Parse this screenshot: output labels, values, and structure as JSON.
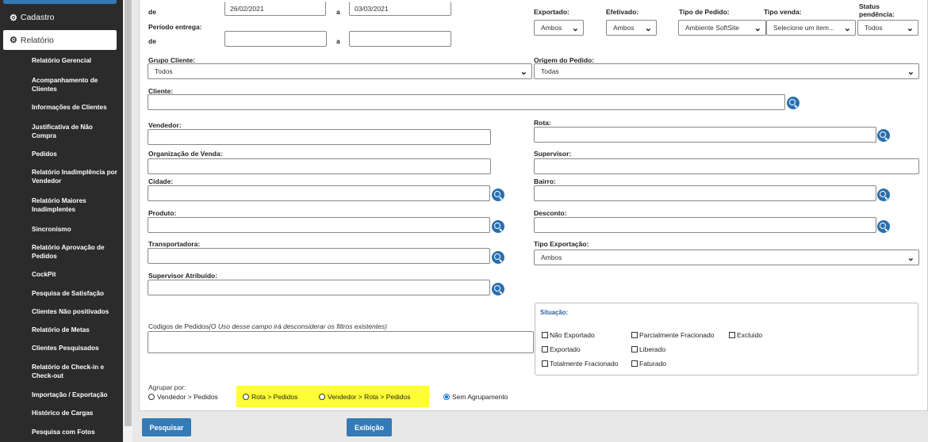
{
  "sidebar": {
    "cadastro": "Cadastro",
    "relatorio": "Relatório",
    "items": [
      "Relatório Gerencial",
      "Acompanhamento de Clientes",
      "Informações de Clientes",
      "Justificativa de Não Compra",
      "Pedidos",
      "Relatório Inadimplência por Vendedor",
      "Relatório Maiores Inadimplentes",
      "Sincronismo",
      "Relatório Aprovação de Pedidos",
      "CockPit",
      "Pesquisa de Satisfação",
      "Clientes Não positivados",
      "Relatório de Metas",
      "Clientes Pesquisados",
      "Relatório de Check-in e Check-out",
      "Importação / Exportação",
      "Histórico de Cargas",
      "Pesquisa com Fotos"
    ]
  },
  "form": {
    "de_label": "de",
    "a_label": "a",
    "date_from": "26/02/2021",
    "date_to": "03/03/2021",
    "periodo_entrega": "Período entrega:",
    "exportado": {
      "label": "Exportado:",
      "value": "Ambos"
    },
    "efetivado": {
      "label": "Efetivado:",
      "value": "Ambos"
    },
    "tipo_pedido": {
      "label": "Tipo de Pedido:",
      "value": "Ambiente SoftSite"
    },
    "tipo_venda": {
      "label": "Tipo venda:",
      "value": "Selecione um item..."
    },
    "status_pendencia": {
      "label": "Status pendência:",
      "value": "Todos"
    },
    "grupo_cliente": {
      "label": "Grupo Cliente:",
      "value": "Todos"
    },
    "origem_pedido": {
      "label": "Origem do Pedido:",
      "value": "Todas"
    },
    "cliente": "Cliente:",
    "vendedor": "Vendedor:",
    "rota": "Rota:",
    "organizacao": "Organização de Venda:",
    "supervisor": "Supervisor:",
    "cidade": "Cidade:",
    "bairro": "Bairro:",
    "produto": "Produto:",
    "desconto": "Desconto:",
    "transportadora": "Transportadora:",
    "tipo_exportacao": {
      "label": "Tipo Exportação:",
      "value": "Ambos"
    },
    "supervisor_atribuido": "Supervisor Atribuído:",
    "codigos_label": "Codigos de Pedidos",
    "codigos_note": "(O Uso desse campo irá desconsiderar os filtros existentes)",
    "situacao": {
      "title": "Situação:",
      "options": [
        "Não Exportado",
        "Parcialmente Fracionado",
        "Excluido",
        "Exportado",
        "Liberado",
        "Totalmente Fracionado",
        "Faturado"
      ]
    },
    "agrupar": {
      "label": "Agrupar por:",
      "options": [
        "Vendedor > Pedidos",
        "Rota > Pedidos",
        "Vendedor > Rota > Pedidos",
        "Sem Agrupamento"
      ],
      "selected": "Sem Agrupamento"
    }
  },
  "buttons": {
    "pesquisar": "Pesquisar",
    "exibicao": "Exibição"
  },
  "colors": {
    "accent": "#337ab7",
    "sidebar": "#2b2b2b",
    "highlight": "#ffff33"
  }
}
